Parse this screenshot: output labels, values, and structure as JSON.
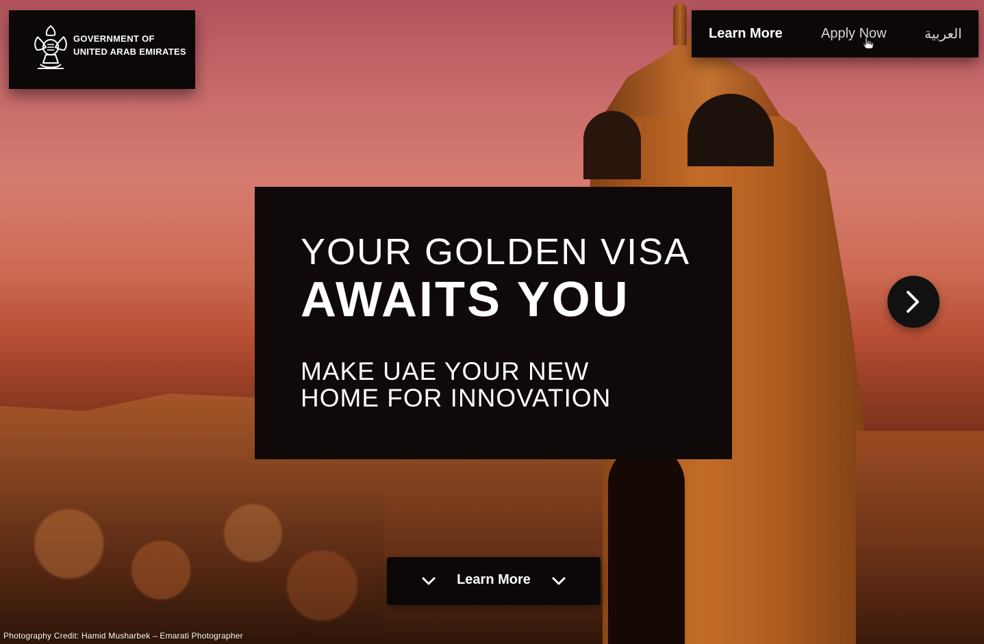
{
  "header": {
    "logo_line1": "GOVERNMENT OF",
    "logo_line2": "UNITED ARAB EMIRATES"
  },
  "nav": {
    "items": [
      {
        "label": "Learn More"
      },
      {
        "label": "Apply Now"
      },
      {
        "label": "العربية"
      }
    ]
  },
  "hero": {
    "title_line1": "YOUR GOLDEN VISA",
    "title_line2": "AWAITS YOU",
    "subtitle_line1": "MAKE UAE YOUR NEW",
    "subtitle_line2": "HOME FOR INNOVATION"
  },
  "cta": {
    "learn_more_label": "Learn More"
  },
  "footer": {
    "photo_credit": "Photography Credit: Hamid Musharbek – Emarati Photographer"
  },
  "icons": {
    "emblem": "uae-emblem-icon",
    "hand_cursor": "hand-cursor-icon",
    "next": "chevron-right-icon",
    "chevron_down": "chevron-down-icon"
  },
  "colors": {
    "panel": "#0c0808",
    "text": "#ffffff",
    "sky_top": "#b2535c",
    "sky_mid": "#d57c6f",
    "earth": "#7a3c14"
  }
}
